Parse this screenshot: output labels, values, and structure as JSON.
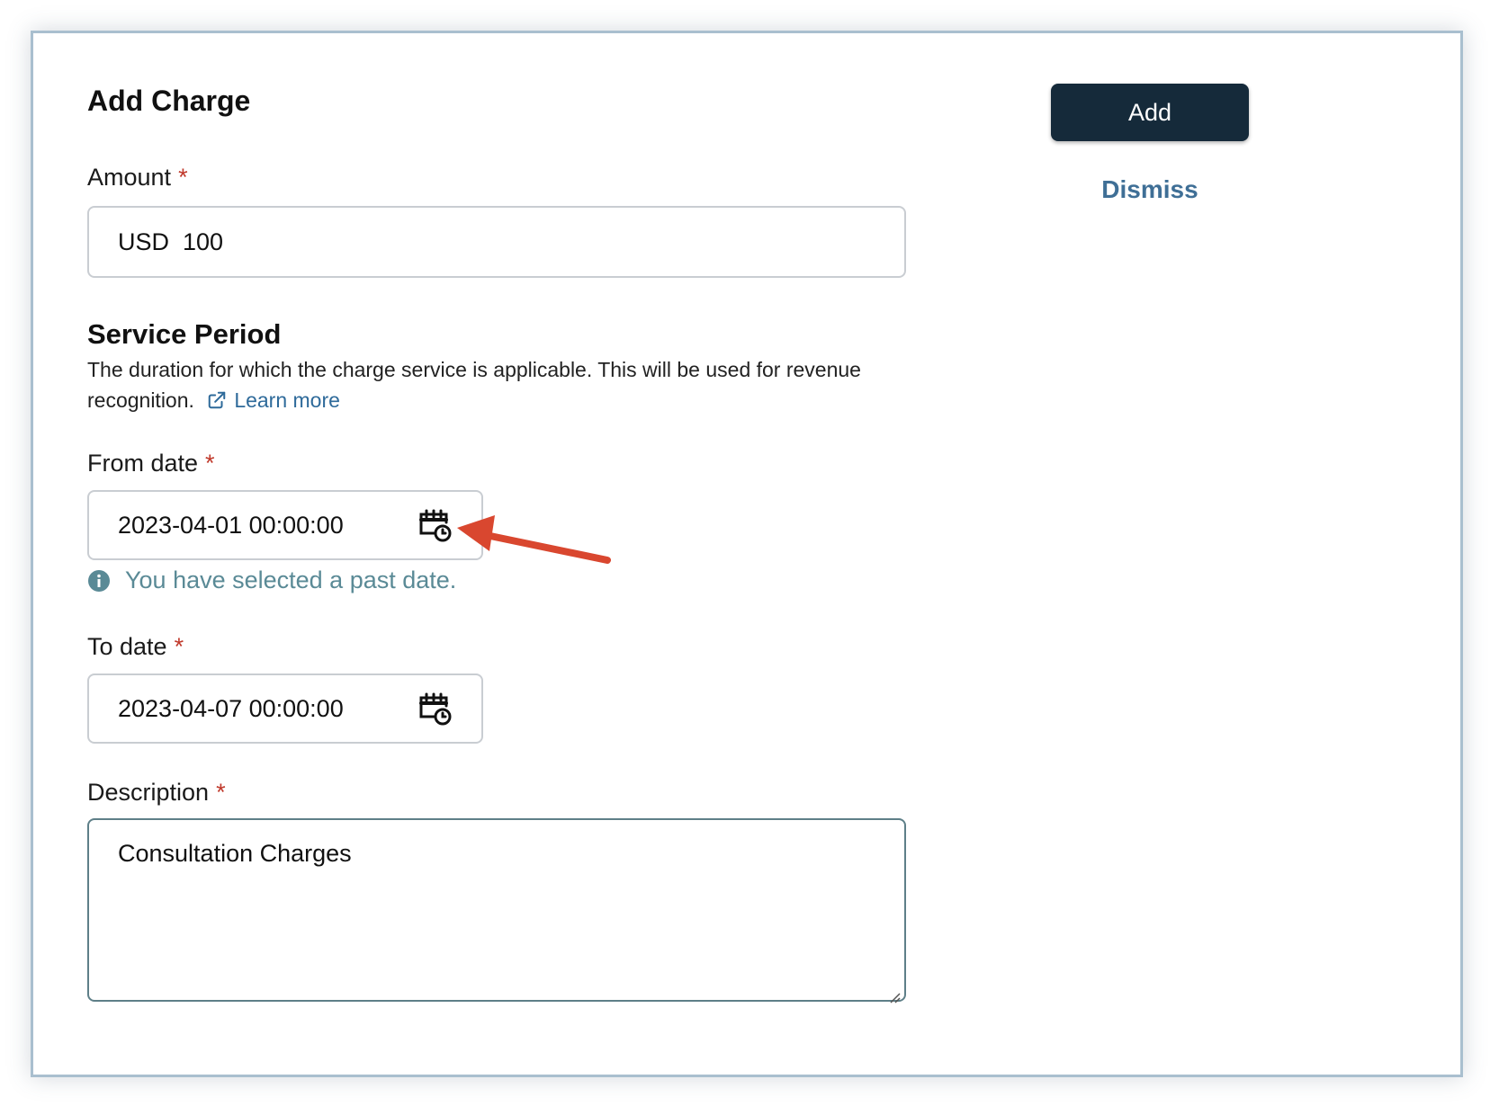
{
  "form": {
    "title": "Add Charge",
    "amount": {
      "label": "Amount",
      "required": "*",
      "value": "USD  100"
    },
    "service_period": {
      "title": "Service Period",
      "description": "The duration for which the charge service is applicable. This will be used for revenue recognition.",
      "learn_more": "Learn more"
    },
    "from_date": {
      "label": "From date",
      "required": "*",
      "value": "2023-04-01 00:00:00",
      "warning": "You have selected a past date."
    },
    "to_date": {
      "label": "To date",
      "required": "*",
      "value": "2023-04-07 00:00:00"
    },
    "description": {
      "label": "Description",
      "required": "*",
      "value": "Consultation Charges"
    }
  },
  "actions": {
    "add_label": "Add",
    "dismiss_label": "Dismiss"
  },
  "colors": {
    "add_button_bg": "#152a3a",
    "link": "#2e6a9a",
    "required": "#c0392b",
    "warning_text": "#5a8a96",
    "annotation_arrow": "#d9472f"
  },
  "icons": {
    "calendar": "calendar-clock-icon",
    "external_link": "external-link-icon",
    "info": "info-icon",
    "resize": "resize-handle-icon"
  }
}
